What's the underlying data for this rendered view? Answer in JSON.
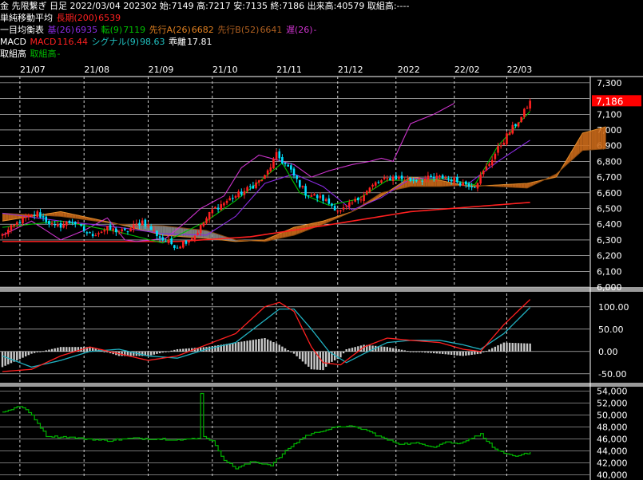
{
  "header": {
    "line1": "金 先限繋ぎ 日足 2022/03/04 202302 始:7149 高:7217 安:7135 終:7186 出来高:40579 取組高:----",
    "line2": {
      "title": "単純移動平均",
      "ma_label": "長期(200)",
      "ma_value": "6539"
    },
    "line3": {
      "title": "一目均衡表",
      "kijun_label": "基(26)",
      "kijun_value": "6935",
      "tenkan_label": "転(9)",
      "tenkan_value": "7119",
      "senkouA_label": "先行A(26)",
      "senkouA_value": "6682",
      "senkouB_label": "先行B(52)",
      "senkouB_value": "6641",
      "chikou_label": "遅(26)",
      "chikou_value": "-"
    },
    "line4": {
      "title": "MACD",
      "macd_label": "MACD",
      "macd_value": "116.44",
      "signal_label": "シグナル(9)",
      "signal_value": "98.63",
      "hist_label": "乖離",
      "hist_value": "17.81"
    },
    "line5": {
      "title": "取組高",
      "oi_label": "取組高",
      "oi_value": "-"
    }
  },
  "colors": {
    "up": "#ff2020",
    "down": "#00e0ff",
    "ma200": "#ff2020",
    "kijun": "#8a2be2",
    "tenkan": "#00c000",
    "cloud_up": "#cc6a1a",
    "cloud_down": "#909090",
    "chikou": "#cc33cc",
    "macd": "#ff2020",
    "signal": "#20b0c0",
    "hist": "#c8c8c8",
    "oi": "#00b000",
    "grid": "#ffffff",
    "last_price_bg": "#ff0000"
  },
  "chart_data": [
    {
      "type": "candlestick",
      "title": "",
      "x_labels": [
        "21/07",
        "21/08",
        "21/09",
        "21/10",
        "21/11",
        "21/12",
        "2022",
        "22/02",
        "22/03"
      ],
      "y_ticks": [
        6000,
        6100,
        6200,
        6300,
        6400,
        6500,
        6600,
        6700,
        6800,
        6900,
        7000,
        7100,
        7200,
        7300
      ],
      "y_tick_labels": [
        "6,000",
        "6,100",
        "6,200",
        "6,300",
        "6,400",
        "6,500",
        "6,600",
        "6,700",
        "6,800",
        "6,900",
        "7,000",
        "7,100",
        "7,200",
        "7,300"
      ],
      "ylim": [
        6000,
        7340
      ],
      "last_price": 7186,
      "last_price_label": "7,186",
      "close_anchors": [
        [
          0,
          6330
        ],
        [
          6,
          6420
        ],
        [
          12,
          6470
        ],
        [
          18,
          6380
        ],
        [
          24,
          6420
        ],
        [
          30,
          6330
        ],
        [
          36,
          6370
        ],
        [
          42,
          6350
        ],
        [
          48,
          6420
        ],
        [
          55,
          6300
        ],
        [
          60,
          6260
        ],
        [
          66,
          6330
        ],
        [
          72,
          6490
        ],
        [
          78,
          6560
        ],
        [
          84,
          6620
        ],
        [
          90,
          6700
        ],
        [
          94,
          6840
        ],
        [
          98,
          6760
        ],
        [
          104,
          6600
        ],
        [
          110,
          6560
        ],
        [
          116,
          6480
        ],
        [
          122,
          6560
        ],
        [
          128,
          6660
        ],
        [
          134,
          6700
        ],
        [
          140,
          6680
        ],
        [
          146,
          6690
        ],
        [
          152,
          6700
        ],
        [
          158,
          6660
        ],
        [
          162,
          6650
        ],
        [
          166,
          6760
        ],
        [
          170,
          6880
        ],
        [
          174,
          6990
        ],
        [
          178,
          7080
        ],
        [
          181,
          7186
        ]
      ],
      "ma200_anchors": [
        [
          0,
          6290
        ],
        [
          60,
          6290
        ],
        [
          85,
          6320
        ],
        [
          110,
          6390
        ],
        [
          140,
          6480
        ],
        [
          181,
          6539
        ]
      ],
      "ichimoku_kijun_anchors": [
        [
          0,
          6470
        ],
        [
          20,
          6420
        ],
        [
          40,
          6380
        ],
        [
          55,
          6340
        ],
        [
          70,
          6330
        ],
        [
          80,
          6450
        ],
        [
          90,
          6660
        ],
        [
          100,
          6720
        ],
        [
          110,
          6640
        ],
        [
          120,
          6490
        ],
        [
          130,
          6570
        ],
        [
          140,
          6690
        ],
        [
          150,
          6690
        ],
        [
          160,
          6660
        ],
        [
          170,
          6800
        ],
        [
          181,
          6935
        ]
      ],
      "ichimoku_tenkan_anchors": [
        [
          0,
          6380
        ],
        [
          20,
          6420
        ],
        [
          40,
          6350
        ],
        [
          55,
          6280
        ],
        [
          70,
          6420
        ],
        [
          80,
          6550
        ],
        [
          90,
          6700
        ],
        [
          96,
          6790
        ],
        [
          102,
          6600
        ],
        [
          112,
          6520
        ],
        [
          122,
          6560
        ],
        [
          132,
          6680
        ],
        [
          142,
          6680
        ],
        [
          152,
          6690
        ],
        [
          162,
          6650
        ],
        [
          170,
          6900
        ],
        [
          181,
          7119
        ]
      ],
      "ichimoku_chikou_anchors": [
        [
          0,
          6330
        ],
        [
          10,
          6420
        ],
        [
          20,
          6300
        ],
        [
          28,
          6360
        ],
        [
          36,
          6440
        ],
        [
          42,
          6300
        ],
        [
          46,
          6290
        ],
        [
          56,
          6310
        ],
        [
          62,
          6400
        ],
        [
          68,
          6500
        ],
        [
          76,
          6580
        ],
        [
          82,
          6760
        ],
        [
          88,
          6840
        ],
        [
          94,
          6810
        ],
        [
          100,
          6780
        ],
        [
          106,
          6700
        ],
        [
          112,
          6740
        ],
        [
          120,
          6780
        ],
        [
          126,
          6800
        ],
        [
          130,
          6820
        ],
        [
          134,
          6800
        ],
        [
          140,
          7040
        ],
        [
          148,
          7100
        ],
        [
          155,
          7170
        ]
      ],
      "senkouA_anchors": [
        [
          0,
          6420
        ],
        [
          20,
          6480
        ],
        [
          40,
          6400
        ],
        [
          55,
          6330
        ],
        [
          70,
          6310
        ],
        [
          80,
          6290
        ],
        [
          90,
          6300
        ],
        [
          100,
          6380
        ],
        [
          110,
          6420
        ],
        [
          120,
          6480
        ],
        [
          130,
          6580
        ],
        [
          140,
          6700
        ],
        [
          150,
          6680
        ],
        [
          160,
          6640
        ],
        [
          170,
          6650
        ],
        [
          180,
          6660
        ],
        [
          190,
          6700
        ],
        [
          199,
          6980
        ],
        [
          207,
          7020
        ]
      ],
      "senkouB_anchors": [
        [
          0,
          6470
        ],
        [
          20,
          6450
        ],
        [
          40,
          6400
        ],
        [
          55,
          6390
        ],
        [
          70,
          6360
        ],
        [
          80,
          6300
        ],
        [
          90,
          6290
        ],
        [
          100,
          6330
        ],
        [
          110,
          6400
        ],
        [
          120,
          6480
        ],
        [
          130,
          6600
        ],
        [
          140,
          6640
        ],
        [
          150,
          6640
        ],
        [
          160,
          6650
        ],
        [
          170,
          6640
        ],
        [
          180,
          6630
        ],
        [
          190,
          6720
        ],
        [
          199,
          6870
        ],
        [
          207,
          6880
        ]
      ],
      "cloud_gray_range": [
        35,
        80
      ]
    },
    {
      "type": "line",
      "title": "",
      "series_names": [
        "MACD",
        "シグナル(9)",
        "乖離"
      ],
      "y_ticks": [
        -50,
        0,
        50,
        100
      ],
      "y_tick_labels": [
        "-50.00",
        "0.00",
        "50.00",
        "100.00"
      ],
      "ylim": [
        -70,
        130
      ],
      "macd_anchors": [
        [
          0,
          -45
        ],
        [
          10,
          -40
        ],
        [
          20,
          -10
        ],
        [
          30,
          10
        ],
        [
          40,
          -5
        ],
        [
          50,
          -20
        ],
        [
          60,
          -10
        ],
        [
          70,
          15
        ],
        [
          80,
          40
        ],
        [
          90,
          100
        ],
        [
          95,
          110
        ],
        [
          100,
          90
        ],
        [
          106,
          10
        ],
        [
          110,
          -25
        ],
        [
          116,
          -30
        ],
        [
          124,
          10
        ],
        [
          132,
          30
        ],
        [
          140,
          25
        ],
        [
          150,
          20
        ],
        [
          158,
          5
        ],
        [
          164,
          0
        ],
        [
          172,
          60
        ],
        [
          181,
          116.44
        ]
      ],
      "signal_anchors": [
        [
          0,
          -10
        ],
        [
          10,
          -35
        ],
        [
          20,
          -20
        ],
        [
          30,
          0
        ],
        [
          40,
          5
        ],
        [
          50,
          -10
        ],
        [
          60,
          -15
        ],
        [
          70,
          5
        ],
        [
          80,
          20
        ],
        [
          90,
          70
        ],
        [
          95,
          95
        ],
        [
          100,
          95
        ],
        [
          106,
          50
        ],
        [
          112,
          0
        ],
        [
          118,
          -25
        ],
        [
          124,
          -5
        ],
        [
          132,
          20
        ],
        [
          140,
          25
        ],
        [
          150,
          25
        ],
        [
          158,
          15
        ],
        [
          164,
          5
        ],
        [
          172,
          40
        ],
        [
          181,
          98.63
        ]
      ],
      "last_macd": 116.44,
      "last_signal": 98.63,
      "last_hist": 17.81
    },
    {
      "type": "line",
      "title": "",
      "series_names": [
        "取組高"
      ],
      "y_ticks": [
        40000,
        42000,
        44000,
        46000,
        48000,
        50000,
        52000,
        54000
      ],
      "y_tick_labels": [
        "40,000",
        "42,000",
        "44,000",
        "46,000",
        "48,000",
        "50,000",
        "52,000",
        "54,000"
      ],
      "ylim": [
        39400,
        54600
      ],
      "oi_anchors": [
        [
          0,
          50500
        ],
        [
          6,
          51500
        ],
        [
          10,
          50000
        ],
        [
          15,
          46500
        ],
        [
          25,
          46200
        ],
        [
          35,
          45700
        ],
        [
          45,
          46100
        ],
        [
          55,
          46000
        ],
        [
          62,
          45800
        ],
        [
          67,
          46200
        ],
        [
          68,
          53500
        ],
        [
          69,
          46500
        ],
        [
          72,
          45600
        ],
        [
          76,
          42500
        ],
        [
          80,
          41100
        ],
        [
          86,
          42200
        ],
        [
          92,
          41600
        ],
        [
          98,
          44400
        ],
        [
          104,
          46600
        ],
        [
          112,
          47700
        ],
        [
          118,
          48200
        ],
        [
          124,
          47600
        ],
        [
          130,
          46200
        ],
        [
          136,
          45200
        ],
        [
          142,
          45300
        ],
        [
          148,
          44700
        ],
        [
          152,
          45500
        ],
        [
          156,
          45200
        ],
        [
          160,
          46000
        ],
        [
          164,
          46800
        ],
        [
          168,
          44600
        ],
        [
          172,
          43500
        ],
        [
          176,
          43000
        ],
        [
          181,
          43800
        ]
      ]
    }
  ]
}
